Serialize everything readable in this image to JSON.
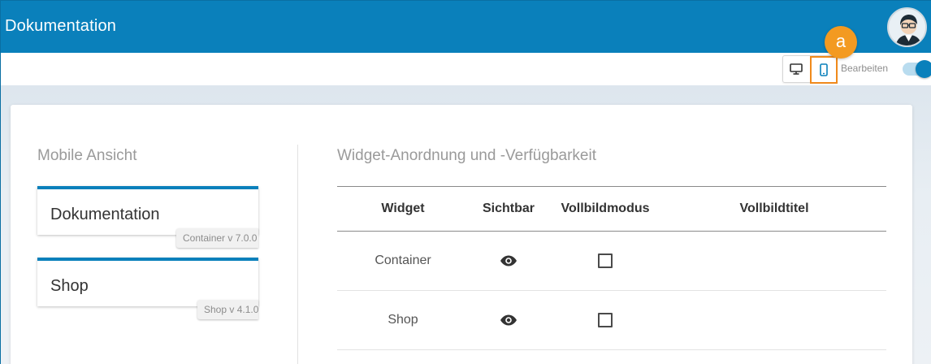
{
  "header": {
    "title": "Dokumentation"
  },
  "toolbar": {
    "desktop_icon": "monitor-icon",
    "mobile_icon": "smartphone-icon",
    "callout_label": "a",
    "edit_label": "Bearbeiten",
    "edit_toggle_on": true,
    "accent_color": "#0a80bb",
    "highlight_color": "#f08a1c"
  },
  "mobile_view": {
    "title": "Mobile Ansicht",
    "widgets": [
      {
        "name": "Dokumentation",
        "version": "Container v 7.0.0"
      },
      {
        "name": "Shop",
        "version": "Shop v 4.1.0"
      }
    ]
  },
  "arrangement": {
    "title": "Widget-Anordnung und -Verfügbarkeit",
    "columns": [
      "Widget",
      "Sichtbar",
      "Vollbildmodus",
      "Vollbildtitel"
    ],
    "rows": [
      {
        "widget": "Container",
        "visible_icon": "eye-icon",
        "fullscreen": false,
        "fullscreen_title": ""
      },
      {
        "widget": "Shop",
        "visible_icon": "eye-icon",
        "fullscreen": false,
        "fullscreen_title": ""
      }
    ]
  }
}
